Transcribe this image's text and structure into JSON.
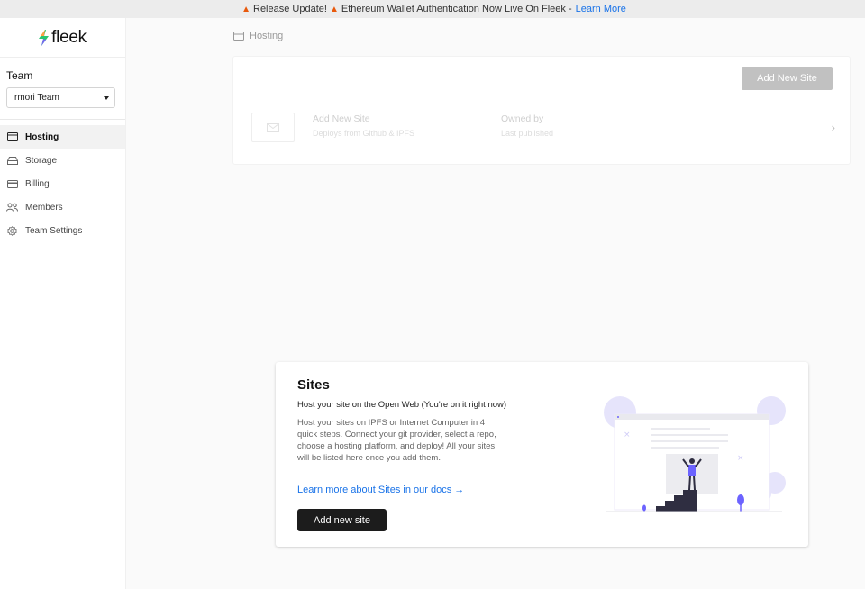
{
  "banner": {
    "text": "Release Update!",
    "text2": "Ethereum Wallet Authentication Now Live On Fleek -",
    "link": "Learn More"
  },
  "sidebar": {
    "logo": "fleek",
    "team_label": "Team",
    "team_selected": "rmori Team",
    "items": [
      {
        "label": "Hosting",
        "icon": "browser-window-icon",
        "active": true
      },
      {
        "label": "Storage",
        "icon": "drive-icon",
        "active": false
      },
      {
        "label": "Billing",
        "icon": "credit-card-icon",
        "active": false
      },
      {
        "label": "Members",
        "icon": "users-icon",
        "active": false
      },
      {
        "label": "Team Settings",
        "icon": "gear-icon",
        "active": false
      }
    ]
  },
  "breadcrumb": {
    "label": "Hosting",
    "icon": "browser-window-icon"
  },
  "sites_list": {
    "add_button": "Add New Site",
    "row": {
      "title": "Add New Site",
      "subtitle": "Deploys from Github & IPFS",
      "owner_title": "Owned by",
      "owner_sub": "Last published"
    }
  },
  "empty_state": {
    "title": "Sites",
    "subtitle": "Host your site on the Open Web (You're on it right now)",
    "description": "Host your sites on IPFS or Internet Computer in 4 quick steps. Connect your git provider, select a repo, choose a hosting platform, and deploy! All your sites will be listed here once you add them.",
    "link": "Learn more about Sites in our docs →",
    "button": "Add new site"
  },
  "colors": {
    "accent_link": "#1a73e8",
    "illustration_purple": "#6c63ff",
    "button_dark": "#1c1c1c",
    "button_disabled": "#c1c1c1"
  }
}
